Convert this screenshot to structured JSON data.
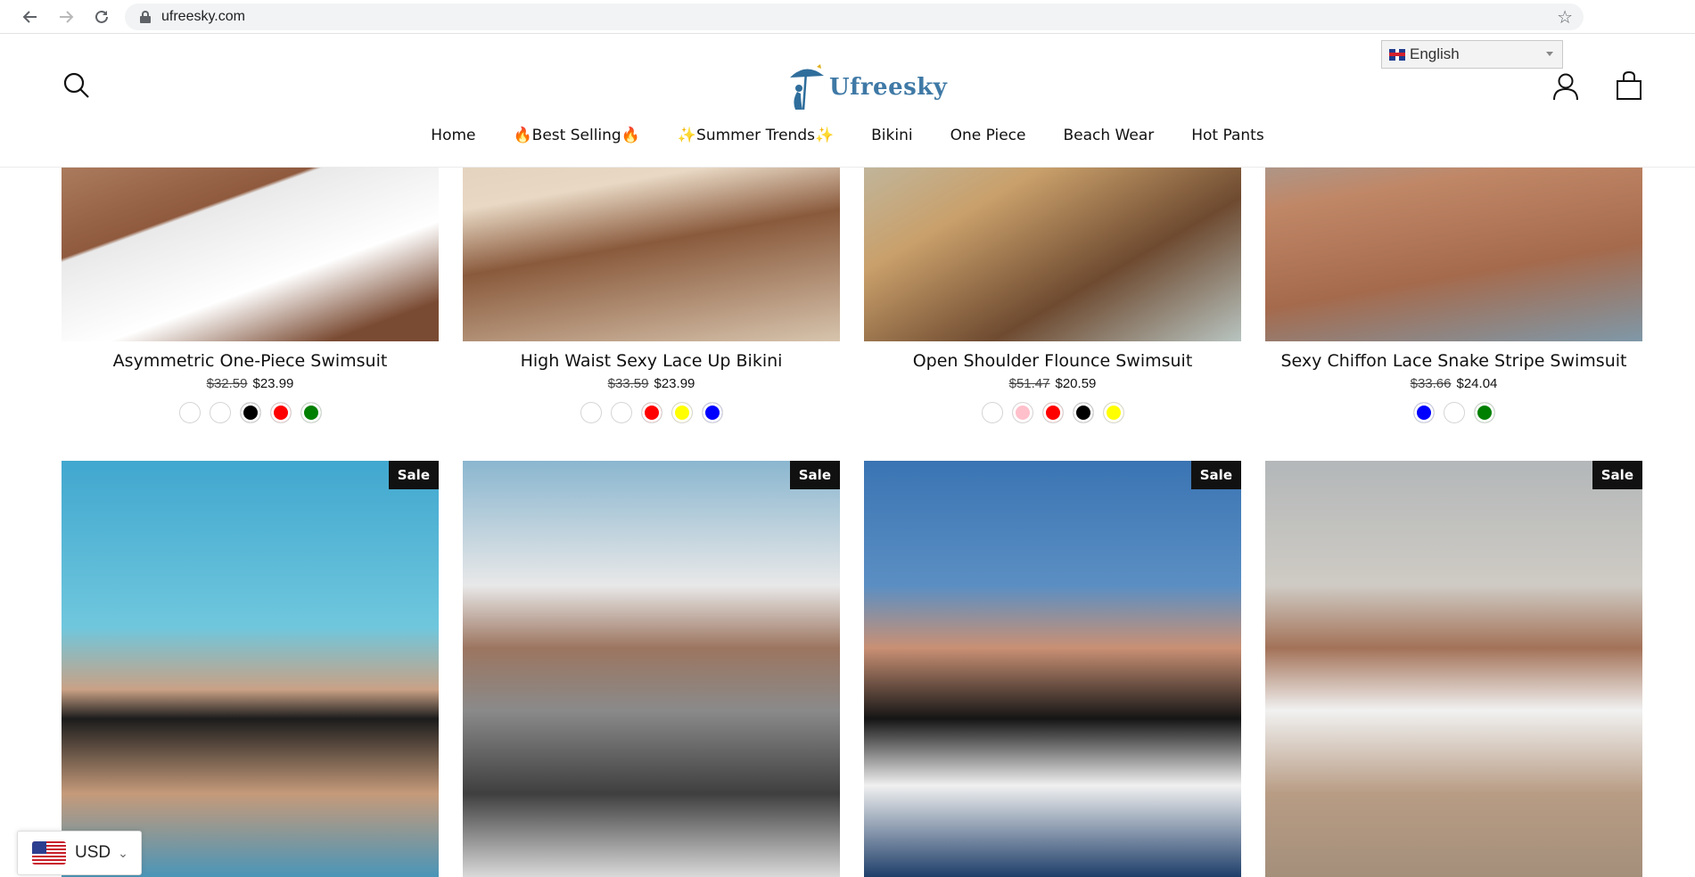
{
  "browser": {
    "url": "ufreesky.com",
    "icons": [
      "back-arrow-icon",
      "forward-arrow-icon",
      "reload-icon",
      "lock-icon",
      "bookmark-star-icon"
    ]
  },
  "header": {
    "logo_text": "Ufreesky",
    "language": "English",
    "icons": [
      "search-icon",
      "account-icon",
      "cart-icon"
    ]
  },
  "nav": {
    "items": [
      {
        "label": "Home"
      },
      {
        "label": "🔥Best Selling🔥"
      },
      {
        "label": "✨Summer Trends✨"
      },
      {
        "label": "Bikini"
      },
      {
        "label": "One Piece"
      },
      {
        "label": "Beach Wear"
      },
      {
        "label": "Hot Pants"
      }
    ]
  },
  "products_row1": [
    {
      "title": "Asymmetric One-Piece Swimsuit",
      "old_price": "$32.59",
      "price": "$23.99",
      "colors": [
        "#ffffff",
        "#ffffff",
        "#000000",
        "#ff0000",
        "#008000"
      ]
    },
    {
      "title": "High Waist Sexy Lace Up Bikini",
      "old_price": "$33.59",
      "price": "$23.99",
      "colors": [
        "#ffffff",
        "#ffffff",
        "#ff0000",
        "#ffff00",
        "#0000ff"
      ]
    },
    {
      "title": "Open Shoulder Flounce Swimsuit",
      "old_price": "$51.47",
      "price": "$20.59",
      "colors": [
        "#ffffff",
        "#ffc0cb",
        "#ff0000",
        "#000000",
        "#ffff00"
      ]
    },
    {
      "title": "Sexy Chiffon Lace Snake Stripe Swimsuit",
      "old_price": "$33.66",
      "price": "$24.04",
      "colors": [
        "#0000ff",
        "#ffffff",
        "#008000"
      ]
    }
  ],
  "products_row2": [
    {
      "badge": "Sale"
    },
    {
      "badge": "Sale"
    },
    {
      "badge": "Sale"
    },
    {
      "badge": "Sale"
    }
  ],
  "currency": {
    "code": "USD"
  }
}
